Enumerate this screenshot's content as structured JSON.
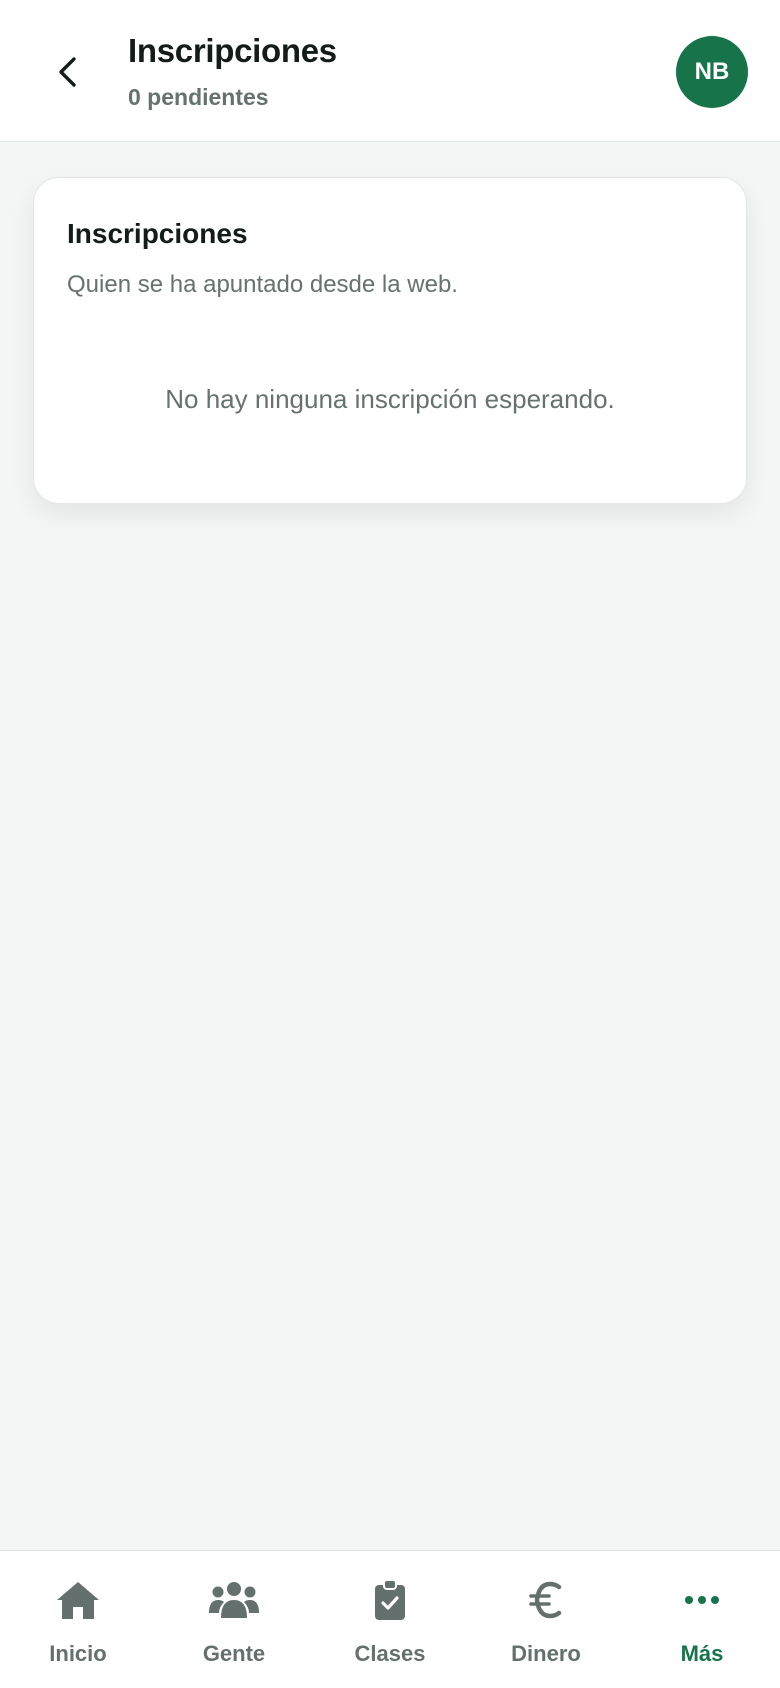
{
  "header": {
    "back_icon": "chevron-left-icon",
    "title": "Inscripciones",
    "subtitle": "0 pendientes",
    "avatar_initials": "NB",
    "avatar_color": "#17744a"
  },
  "card": {
    "title": "Inscripciones",
    "subtitle": "Quien se ha apuntado desde la web.",
    "empty_message": "No hay ninguna inscripción esperando."
  },
  "bottom_nav": {
    "items": [
      {
        "label": "Inicio",
        "icon": "home-icon",
        "active": false
      },
      {
        "label": "Gente",
        "icon": "people-icon",
        "active": false
      },
      {
        "label": "Clases",
        "icon": "clipboard-check-icon",
        "active": false
      },
      {
        "label": "Dinero",
        "icon": "euro-icon",
        "active": false
      },
      {
        "label": "Más",
        "icon": "more-dots-icon",
        "active": true
      }
    ],
    "active_color": "#17744a",
    "inactive_color": "#63706d"
  }
}
